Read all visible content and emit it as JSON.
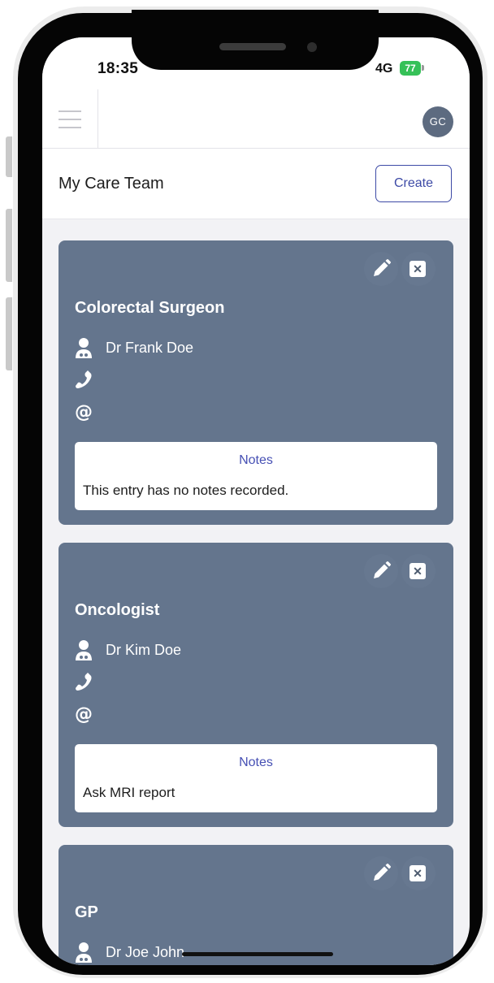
{
  "status_bar": {
    "time": "18:35",
    "network": "4G",
    "battery": "77"
  },
  "header": {
    "avatar_initials": "GC"
  },
  "page": {
    "title": "My Care Team",
    "create_label": "Create"
  },
  "cards": [
    {
      "role": "Colorectal Surgeon",
      "doctor": "Dr Frank Doe",
      "phone": "",
      "email": "",
      "notes_label": "Notes",
      "notes": "This entry has no notes recorded."
    },
    {
      "role": "Oncologist",
      "doctor": "Dr Kim Doe",
      "phone": "",
      "email": "",
      "notes_label": "Notes",
      "notes": "Ask MRI report"
    },
    {
      "role": "GP",
      "doctor": "Dr Joe John"
    }
  ],
  "icons": {
    "menu": "hamburger-menu-icon",
    "edit": "pencil-icon",
    "delete": "close-icon",
    "doctor": "doctor-icon",
    "phone": "phone-icon",
    "email": "at-icon"
  },
  "colors": {
    "card_background": "#64758d",
    "accent": "#3d4aa6",
    "avatar": "#5d6b80"
  }
}
